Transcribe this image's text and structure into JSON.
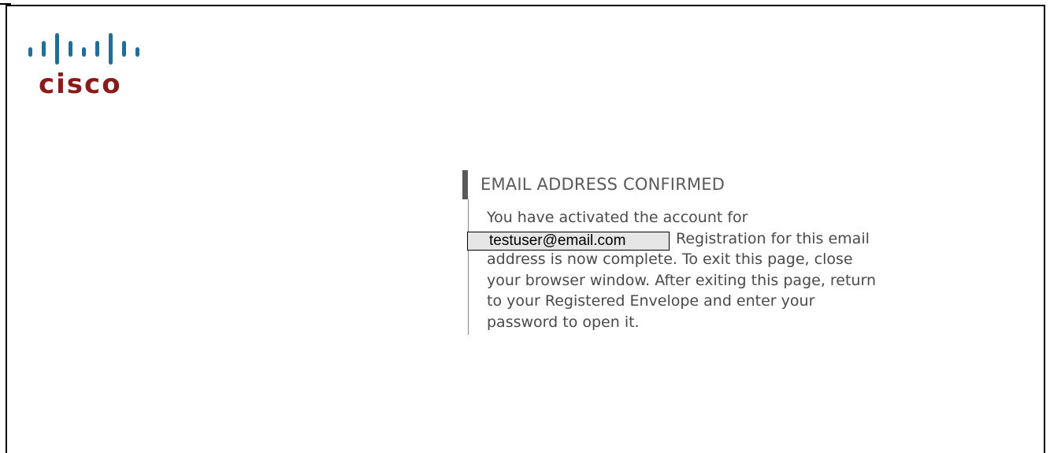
{
  "logo": {
    "wordmark": "cisco",
    "icon": "cisco-bridge-logo",
    "bar_color": "#1f6f9a",
    "text_color": "#8b1a1a"
  },
  "confirmation": {
    "title": "EMAIL ADDRESS CONFIRMED",
    "line1": "You have activated the account for",
    "email": "testuser@email.com",
    "line2_rest": "Registration for this email",
    "line3": "address is now complete. To exit this page, close",
    "line4": "your browser window. After exiting this page, return",
    "line5": "to your Registered Envelope and enter your",
    "line6": "password to open it."
  }
}
